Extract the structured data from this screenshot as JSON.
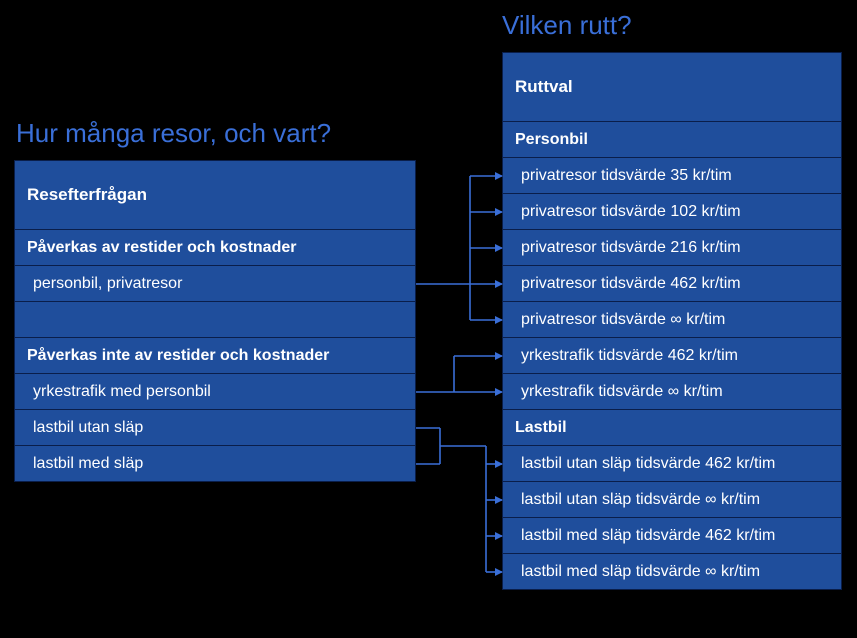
{
  "headings": {
    "left": "Hur många resor, och vart?",
    "right": "Vilken rutt?"
  },
  "left": {
    "header": "Resefterfrågan",
    "sub1": "Påverkas av restider och kostnader",
    "rows1": [
      "personbil, privatresor"
    ],
    "sub2": "Påverkas inte av restider och kostnader",
    "rows2": [
      "yrkestrafik med personbil",
      "lastbil utan släp",
      "lastbil med släp"
    ]
  },
  "right": {
    "header": "Ruttval",
    "sub_personbil": "Personbil",
    "personbil_rows": [
      "privatresor tidsvärde 35 kr/tim",
      "privatresor tidsvärde 102 kr/tim",
      "privatresor tidsvärde 216 kr/tim",
      "privatresor tidsvärde 462 kr/tim",
      "privatresor tidsvärde  ∞ kr/tim",
      "yrkestrafik tidsvärde 462 kr/tim",
      "yrkestrafik tidsvärde  ∞ kr/tim"
    ],
    "sub_lastbil": "Lastbil",
    "lastbil_rows": [
      "lastbil utan släp tidsvärde 462 kr/tim",
      "lastbil utan släp tidsvärde  ∞ kr/tim",
      "lastbil med släp tidsvärde 462 kr/tim",
      "lastbil med släp tidsvärde  ∞ kr/tim"
    ]
  },
  "colors": {
    "box_bg": "#1f4e9c",
    "box_border": "#0a1e4a",
    "heading": "#3a6fd8",
    "arrow": "#3a6fd8"
  }
}
